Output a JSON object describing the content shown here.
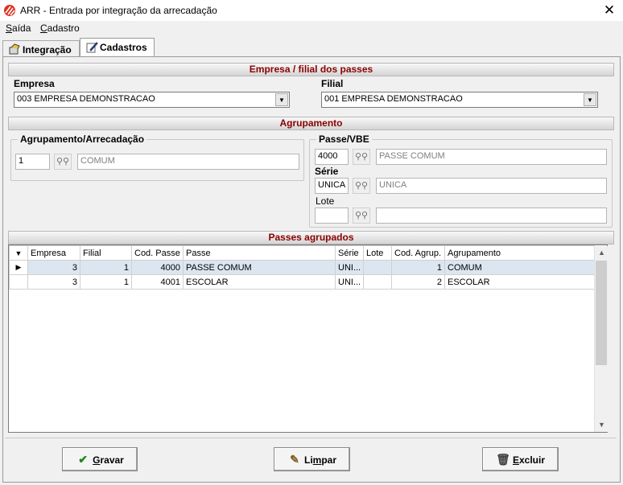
{
  "window": {
    "title": "ARR - Entrada por integração da arrecadação",
    "close_glyph": "✕"
  },
  "menu": {
    "items": [
      {
        "label": "Saída",
        "accel": "S",
        "rest": "aída"
      },
      {
        "label": "Cadastro",
        "accel": "C",
        "rest": "adastro"
      }
    ]
  },
  "tabs": [
    {
      "label": "Integração",
      "icon": "integration-icon"
    },
    {
      "label": "Cadastros",
      "icon": "edit-icon"
    }
  ],
  "empresa_section": {
    "header": "Empresa / filial  dos passes",
    "empresa_label": "Empresa",
    "empresa_value": "003 EMPRESA DEMONSTRACAO",
    "filial_label": "Filial",
    "filial_value": "001 EMPRESA DEMONSTRACAO"
  },
  "agrupamento_section": {
    "header": "Agrupamento",
    "group_label": "Agrupamento/Arrecadação",
    "code": "1",
    "description": "COMUM",
    "passe_group_label": "Passe/VBE",
    "passe_code": "4000",
    "passe_desc": "PASSE COMUM",
    "serie_label": "Série",
    "serie_code": "UNICA",
    "serie_desc": "UNICA",
    "lote_label": "Lote",
    "lote_code": "",
    "lote_desc": ""
  },
  "grid": {
    "header": "Passes agrupados",
    "columns": [
      "Empresa",
      "Filial",
      "Cod. Passe",
      "Passe",
      "Série",
      "Lote",
      "Cod. Agrup.",
      "Agrupamento"
    ],
    "rows": [
      {
        "empresa": "3",
        "filial": "1",
        "cod_passe": "4000",
        "passe": "PASSE COMUM",
        "serie": "UNI...",
        "lote": "",
        "cod_agrup": "1",
        "agrupamento": "COMUM"
      },
      {
        "empresa": "3",
        "filial": "1",
        "cod_passe": "4001",
        "passe": "ESCOLAR",
        "serie": "UNI...",
        "lote": "",
        "cod_agrup": "2",
        "agrupamento": "ESCOLAR"
      }
    ]
  },
  "buttons": {
    "gravar": {
      "accel": "G",
      "rest": "ravar"
    },
    "limpar": {
      "pre": "Li",
      "accel": "m",
      "rest": "par"
    },
    "excluir": {
      "accel": "E",
      "rest": "xcluir"
    }
  },
  "colors": {
    "section_header_text": "#8b0000",
    "selected_row": "#dce6f0"
  }
}
